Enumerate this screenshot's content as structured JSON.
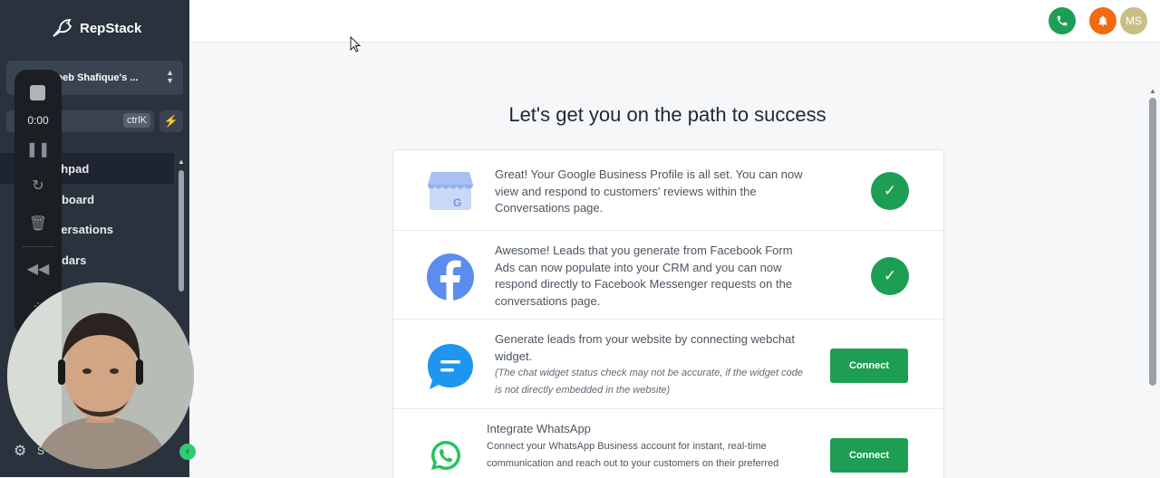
{
  "brand": {
    "name": "RepStack"
  },
  "sidebar": {
    "account_name": "eeb Shafique's ...",
    "search": {
      "placeholder": "h",
      "shortcut": "ctrlK"
    },
    "items": [
      {
        "label": "chpad",
        "active": true
      },
      {
        "label": "hboard",
        "active": false
      },
      {
        "label": "versations",
        "active": false
      },
      {
        "label": "ndars",
        "active": false
      }
    ],
    "settings_label": "S"
  },
  "recorder": {
    "time": "0:00"
  },
  "topbar": {
    "avatar_initials": "MS"
  },
  "main": {
    "title": "Let's get you on the path to success",
    "rows": [
      {
        "text": "Great! Your Google Business Profile is all set. You can now view and respond to customers' reviews within the Conversations page.",
        "status": "done"
      },
      {
        "text": "Awesome! Leads that you generate from Facebook Form Ads can now populate into your CRM and you can now respond directly to Facebook Messenger requests on the conversations page.",
        "status": "done"
      },
      {
        "text": "Generate leads from your website by connecting webchat widget.",
        "note": "(The chat widget status check may not be accurate, if the widget code is not directly embedded in the website)",
        "button": "Connect"
      },
      {
        "title": "Integrate WhatsApp",
        "text": "Connect your WhatsApp Business account for instant, real-time communication and reach out to your customers on their preferred",
        "button": "Connect"
      }
    ]
  },
  "colors": {
    "sidebar_bg": "#2a323e",
    "accent_green": "#1e9e54",
    "bell_orange": "#f26a0f"
  }
}
